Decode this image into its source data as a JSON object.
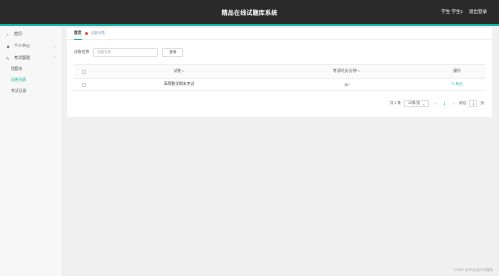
{
  "header": {
    "title": "精品在线试题库系统",
    "user_label": "学生 学生1",
    "logout_label": "退出登录"
  },
  "sidebar": {
    "items": [
      {
        "label": "首页",
        "icon": "home-icon"
      },
      {
        "label": "个人中心",
        "icon": "user-icon"
      },
      {
        "label": "考试管理",
        "icon": "edit-icon"
      }
    ],
    "sub_items": [
      {
        "label": "错题本"
      },
      {
        "label": "试卷列表"
      },
      {
        "label": "考试记录"
      }
    ]
  },
  "tabs": {
    "home": "首页",
    "current": "试卷列表"
  },
  "filter": {
    "label": "试卷名称",
    "placeholder": "试卷名称",
    "query_button": "查询"
  },
  "table": {
    "columns": [
      "试卷",
      "考试时长/分钟",
      "操作"
    ],
    "rows": [
      {
        "name": "高等数学期末考试",
        "duration": "30",
        "action": "考试"
      }
    ]
  },
  "pager": {
    "total": "共 1 条",
    "page_size": "10条/页",
    "prev": "‹",
    "page": "1",
    "next": "›",
    "goto_label": "前往",
    "goto_value": "1",
    "page_unit": "页"
  },
  "colors": {
    "accent": "#16b3a3",
    "topbar": "#2a2a2a"
  },
  "watermark": "CSDN @毕业设计代做网"
}
